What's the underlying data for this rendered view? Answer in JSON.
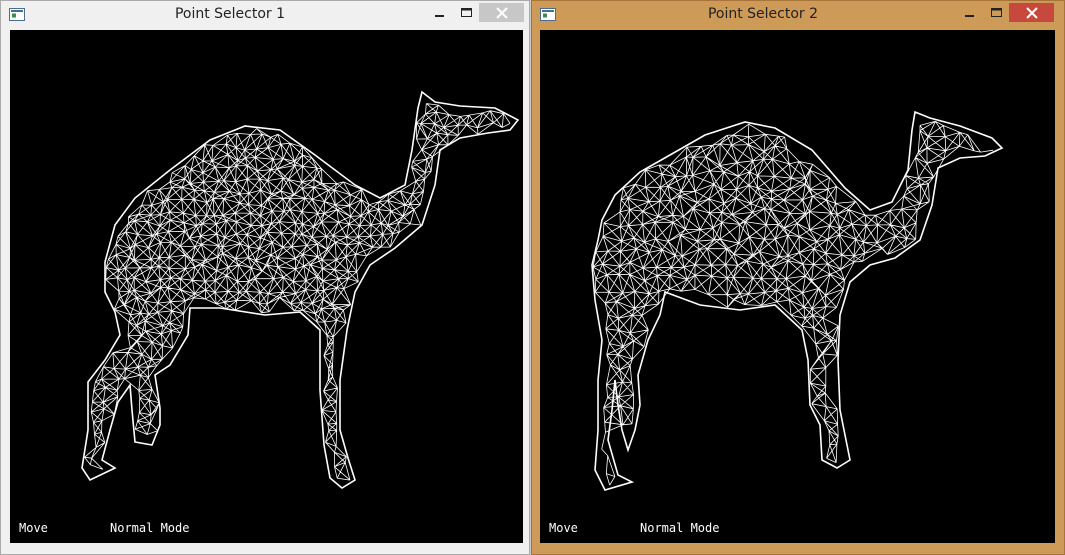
{
  "windows": [
    {
      "title": "Point Selector 1",
      "status_action": "Move",
      "status_mode": "Normal Mode",
      "active": false
    },
    {
      "title": "Point Selector 2",
      "status_action": "Move",
      "status_mode": "Normal Mode",
      "active": true
    }
  ],
  "colors": {
    "active_frame": "#ce9a58",
    "inactive_frame": "#f0f0f0",
    "viewport_bg": "#000000",
    "mesh": "#ffffff",
    "close_active": "#c7483d"
  },
  "icons": [
    "app-icon",
    "minimize-icon",
    "maximize-icon",
    "close-icon"
  ]
}
